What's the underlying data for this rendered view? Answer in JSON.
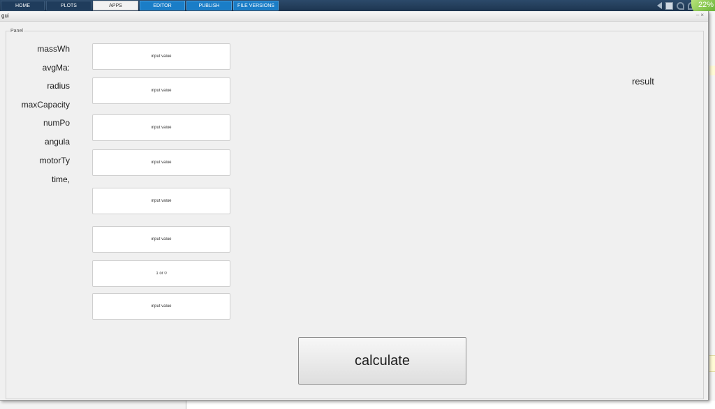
{
  "toolstrip": {
    "tabs": [
      {
        "label": "HOME"
      },
      {
        "label": "PLOTS"
      },
      {
        "label": "APPS"
      },
      {
        "label": "EDITOR"
      },
      {
        "label": "PUBLISH"
      },
      {
        "label": "FILE VERSIONS"
      }
    ],
    "selected_tab": "APPS",
    "badge_text": "22%"
  },
  "window": {
    "title": "gui"
  },
  "panel": {
    "title": "Panel"
  },
  "labels": [
    "massWh",
    "avgMa:",
    "radius",
    "maxCapacity",
    "numPo",
    "angula",
    "motorTy",
    "time,"
  ],
  "inputs": [
    {
      "placeholder": "input value"
    },
    {
      "placeholder": "input value"
    },
    {
      "placeholder": "input value"
    },
    {
      "placeholder": "input value"
    },
    {
      "placeholder": "input value"
    },
    {
      "placeholder": "input value"
    },
    {
      "placeholder": "1 or 0"
    },
    {
      "placeholder": "input value"
    }
  ],
  "result_text": "result",
  "calculate_label": "calculate",
  "colors": {
    "ribbon": "#1d3550",
    "tab_blue": "#1a7dc7",
    "window_bg": "#f0f0f0",
    "badge": "#5fae2e"
  }
}
